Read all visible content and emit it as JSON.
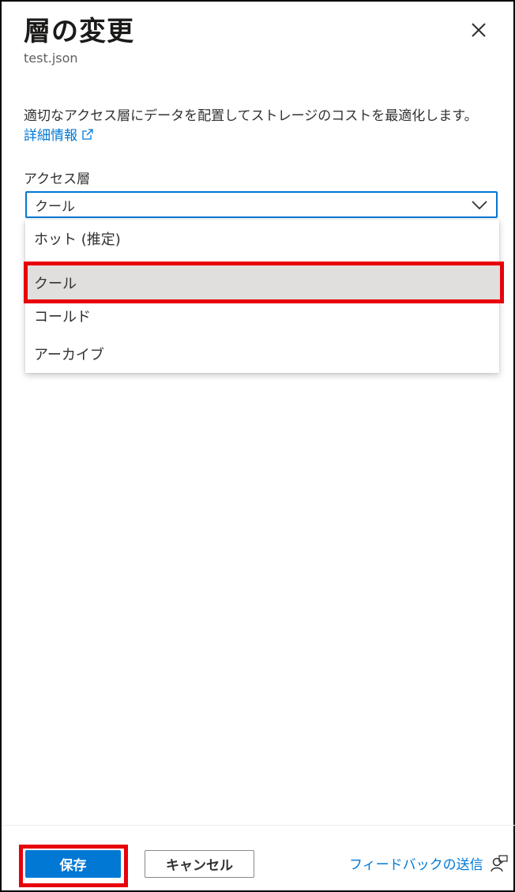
{
  "panel": {
    "title": "層の変更",
    "subtitle": "test.json",
    "description": "適切なアクセス層にデータを配置してストレージのコストを最適化します。",
    "learn_more": "詳細情報"
  },
  "access_tier": {
    "label": "アクセス層",
    "selected": "クール",
    "options": [
      {
        "label": "ホット (推定)"
      },
      {
        "label": "クール"
      },
      {
        "label": "コールド"
      },
      {
        "label": "アーカイブ"
      }
    ],
    "highlighted_index": 1
  },
  "footer": {
    "save_label": "保存",
    "cancel_label": "キャンセル",
    "feedback_label": "フィードバックの送信"
  },
  "colors": {
    "accent": "#0078d4",
    "annotation_red": "#e8000b",
    "selected_bg": "#e1dfdd"
  },
  "icons": {
    "close": "close-icon",
    "external_link": "external-link-icon",
    "dropdown": "chevron-down-icon",
    "feedback": "feedback-person-icon"
  }
}
